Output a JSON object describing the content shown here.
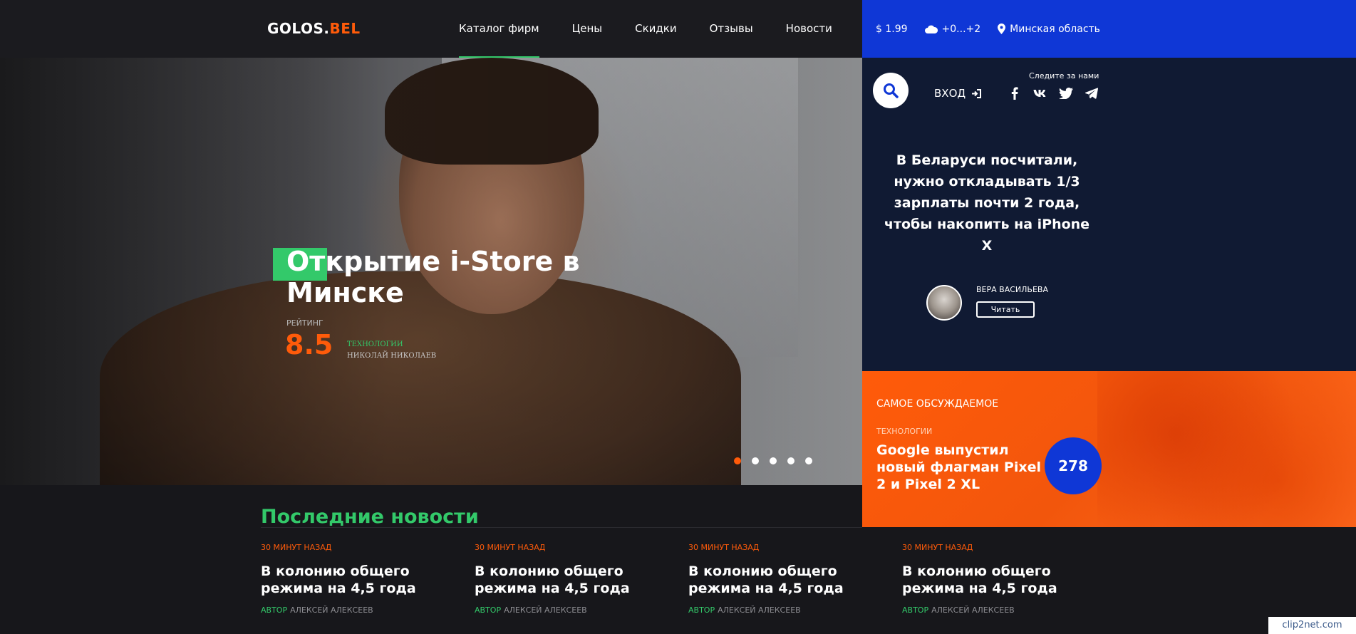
{
  "header": {
    "logo_main": "GOLOS.",
    "logo_accent": "BEL",
    "nav": [
      {
        "label": "Каталог фирм",
        "active": true
      },
      {
        "label": "Цены"
      },
      {
        "label": "Скидки"
      },
      {
        "label": "Отзывы"
      },
      {
        "label": "Новости"
      }
    ],
    "currency": "$ 1.99",
    "weather": "+0...+2",
    "region": "Минская область"
  },
  "hero": {
    "title": "Открытие i-Store в Минске",
    "rating_label": "Рейтинг",
    "rating_value": "8.5",
    "category": "Технологии",
    "author": "Николай Николаев",
    "slides": 5,
    "active_slide": 1
  },
  "side": {
    "login_label": "ВХОД",
    "follow_label": "Следите за нами",
    "socials": [
      "facebook-icon",
      "vk-icon",
      "twitter-icon",
      "telegram-icon"
    ],
    "featured_title": "В Беларуси посчитали, нужно откладывать 1/3 зарплаты почти 2 года, чтобы накопить на iPhone X",
    "author_name": "Вера Васильева",
    "read_label": "Читать"
  },
  "most_discussed": {
    "heading": "Самое обсуждаемое",
    "category": "Технологии",
    "title": "Google выпустил новый флагман Pixel 2 и Pixel 2 XL",
    "comments": "278"
  },
  "latest": {
    "heading": "Последние новости",
    "items": [
      {
        "time": "30 минут назад",
        "title": "В колонию общего режима на 4,5 года",
        "author_label": "Автор",
        "author": "Алексей Алексеев"
      },
      {
        "time": "30 минут назад",
        "title": "В колонию общего режима на 4,5 года",
        "author_label": "Автор",
        "author": "Алексей Алексеев"
      },
      {
        "time": "30 минут назад",
        "title": "В колонию общего режима на 4,5 года",
        "author_label": "Автор",
        "author": "Алексей Алексеев"
      },
      {
        "time": "30 минут назад",
        "title": "В колонию общего режима на 4,5 года",
        "author_label": "Автор",
        "author": "Алексей Алексеев"
      }
    ]
  },
  "watermark": "clip2net.com",
  "colors": {
    "accent_green": "#33c96a",
    "accent_orange": "#ff5b0a",
    "accent_blue": "#0f37d6",
    "panel_dark": "#101a33"
  }
}
